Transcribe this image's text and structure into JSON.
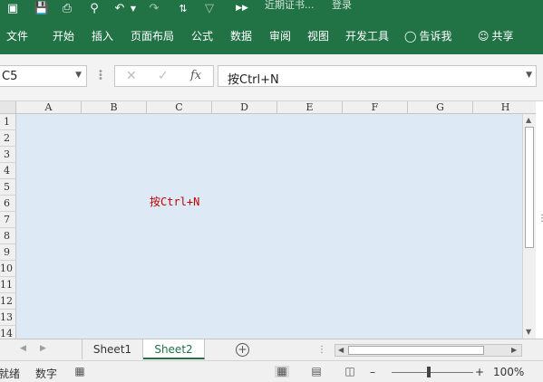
{
  "quick_access": {
    "save_icon": "save-icon",
    "touch_icon": "touch-mode-icon",
    "print_preview_icon": "print-preview-icon",
    "undo_icon": "undo-icon",
    "sort_icon": "sort-icon",
    "more_icon": "more-commands-icon",
    "title": "近期证书...",
    "signin": "登录"
  },
  "ribbon_tabs": [
    "文件",
    "开始",
    "插入",
    "页面布局",
    "公式",
    "数据",
    "审阅",
    "视图",
    "开发工具"
  ],
  "tell_me": "告诉我",
  "share": "共享",
  "formula_bar": {
    "name_box": "C5",
    "fx": "fx",
    "formula": "按Ctrl+N"
  },
  "columns": [
    "A",
    "B",
    "C",
    "D",
    "E",
    "F",
    "G",
    "H"
  ],
  "rows": [
    "1",
    "2",
    "3",
    "4",
    "5",
    "6",
    "7",
    "8",
    "9",
    "10",
    "11",
    "12",
    "13",
    "14"
  ],
  "cell_text": "按Ctrl+N",
  "sheets": [
    "Sheet1",
    "Sheet2"
  ],
  "active_sheet": "Sheet2",
  "status": {
    "ready": "就绪",
    "num": "数字",
    "zoom": "100%"
  },
  "colors": {
    "accent": "#217346",
    "cell_bg": "#ddeaf6",
    "cell_text": "#c00000"
  }
}
